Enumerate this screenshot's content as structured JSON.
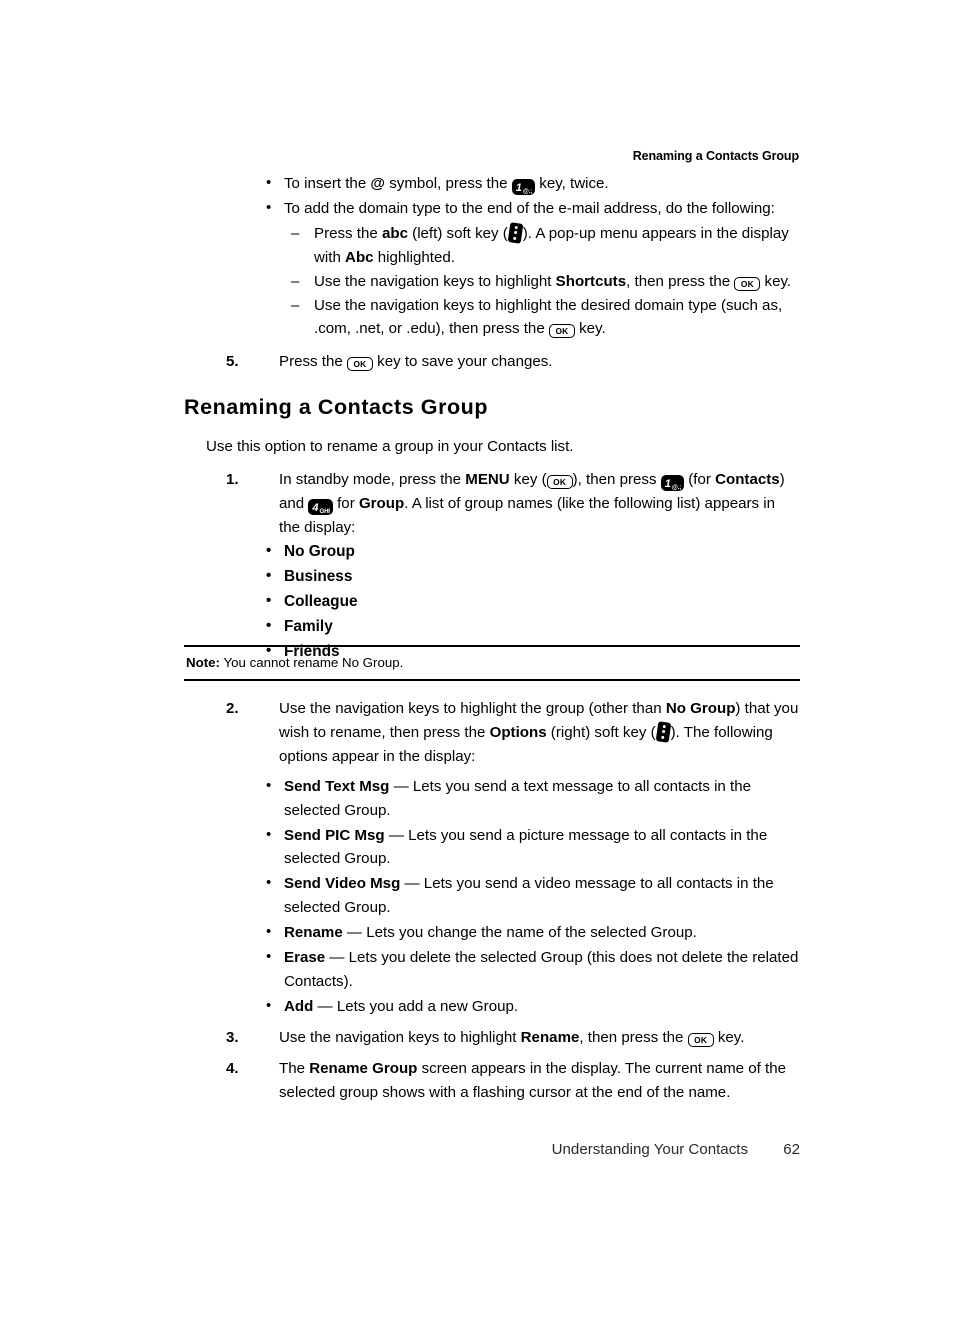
{
  "page": {
    "running_header": "Renaming a Contacts Group",
    "footer_title": "Understanding Your Contacts",
    "footer_page_number": "62"
  },
  "icons": {
    "ok_key_label": "OK",
    "key_1_big": "1",
    "key_1_sub": "@.;",
    "key_4_big": "4",
    "key_4_sub": "GHI",
    "soft_key": "soft-key-icon",
    "at_symbol": "@"
  },
  "top_bullets": [
    {
      "parts": [
        {
          "t": "To insert the "
        },
        {
          "t": "@",
          "style": "at"
        },
        {
          "t": " symbol, press the "
        },
        {
          "t": "",
          "icon": "key1"
        },
        {
          "t": " key, twice."
        }
      ]
    },
    {
      "parts": [
        {
          "t": "To add the domain type to the end of the e-mail address, do the following:"
        }
      ]
    }
  ],
  "sub_dashes": [
    {
      "parts": [
        {
          "t": "Press the "
        },
        {
          "t": "abc",
          "style": "b"
        },
        {
          "t": " (left) soft key ("
        },
        {
          "t": "",
          "icon": "soft"
        },
        {
          "t": "). A pop-up menu appears in the display with "
        },
        {
          "t": "Abc",
          "style": "b"
        },
        {
          "t": " highlighted."
        }
      ]
    },
    {
      "parts": [
        {
          "t": "Use the navigation keys to highlight "
        },
        {
          "t": "Shortcuts",
          "style": "b"
        },
        {
          "t": ", then press the "
        },
        {
          "t": "",
          "icon": "ok"
        },
        {
          "t": " key."
        }
      ]
    },
    {
      "parts": [
        {
          "t": "Use the navigation keys to highlight the desired domain type (such as, .com, .net, or .edu), then press the "
        },
        {
          "t": "",
          "icon": "ok"
        },
        {
          "t": " key."
        }
      ]
    }
  ],
  "step5": {
    "number": "5.",
    "parts": [
      {
        "t": "Press the "
      },
      {
        "t": "",
        "icon": "ok"
      },
      {
        "t": " key to save your changes."
      }
    ]
  },
  "section": {
    "heading": "Renaming a Contacts Group",
    "intro": "Use this option to rename a group in your Contacts list."
  },
  "step1": {
    "number": "1.",
    "parts": [
      {
        "t": "In standby mode, press the "
      },
      {
        "t": "MENU",
        "style": "b"
      },
      {
        "t": " key ("
      },
      {
        "t": "",
        "icon": "ok"
      },
      {
        "t": "), then press "
      },
      {
        "t": "",
        "icon": "key1"
      },
      {
        "t": " (for "
      },
      {
        "t": "Contacts",
        "style": "b"
      },
      {
        "t": ") and "
      },
      {
        "t": "",
        "icon": "key4"
      },
      {
        "t": " for "
      },
      {
        "t": "Group",
        "style": "b"
      },
      {
        "t": ". A list of group names (like the following list) appears in the display:"
      }
    ]
  },
  "group_list": [
    "No Group",
    "Business",
    "Colleague",
    "Family",
    "Friends"
  ],
  "note": {
    "label": "Note:",
    "text": "You cannot rename No Group."
  },
  "step2": {
    "number": "2.",
    "parts": [
      {
        "t": "Use the navigation keys to highlight the group (other than "
      },
      {
        "t": "No Group",
        "style": "b"
      },
      {
        "t": ") that you wish to rename, then press the "
      },
      {
        "t": "Options",
        "style": "b"
      },
      {
        "t": " (right) soft key ("
      },
      {
        "t": "",
        "icon": "soft"
      },
      {
        "t": "). The following options appear in the display:"
      }
    ]
  },
  "options": [
    {
      "term": "Send Text Msg",
      "desc": "— Lets you send a text message to all contacts in the selected Group."
    },
    {
      "term": "Send PIC Msg",
      "desc": "— Lets you send a picture message to all contacts in the selected Group."
    },
    {
      "term": "Send Video Msg",
      "desc": "— Lets you send a video message to all contacts in the selected Group."
    },
    {
      "term": "Rename",
      "desc": "— Lets you change the name of the selected Group."
    },
    {
      "term": "Erase",
      "desc": "— Lets you delete the selected Group (this does not delete the related Contacts)."
    },
    {
      "term": "Add",
      "desc": "— Lets you add a new Group."
    }
  ],
  "step3": {
    "number": "3.",
    "parts": [
      {
        "t": "Use the navigation keys to highlight "
      },
      {
        "t": "Rename",
        "style": "b"
      },
      {
        "t": ", then press the "
      },
      {
        "t": "",
        "icon": "ok"
      },
      {
        "t": " key."
      }
    ]
  },
  "step4": {
    "number": "4.",
    "parts": [
      {
        "t": "The "
      },
      {
        "t": "Rename Group",
        "style": "b"
      },
      {
        "t": " screen appears in the display. The current name of the selected group shows with a flashing cursor at the end of the name."
      }
    ]
  }
}
